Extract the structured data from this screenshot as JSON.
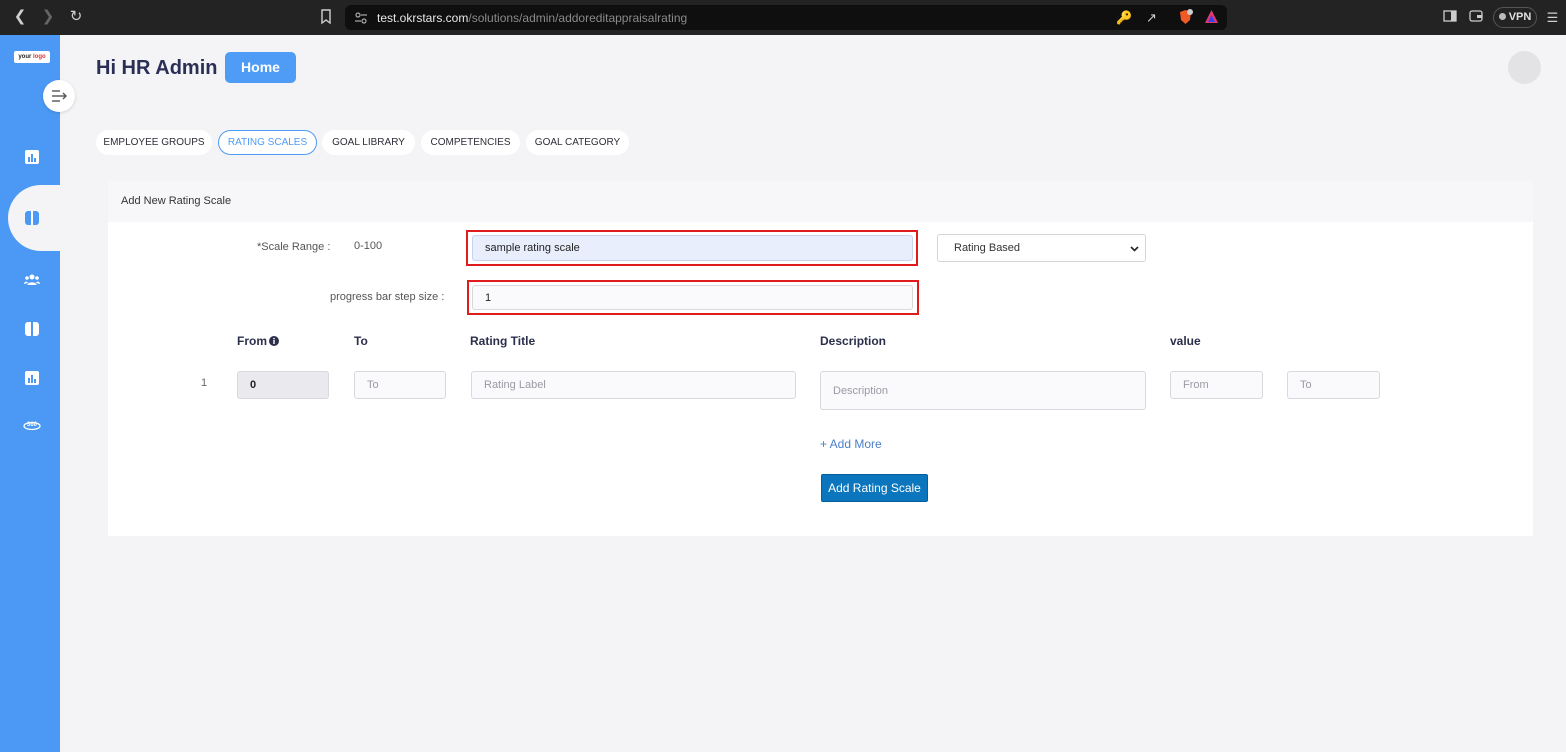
{
  "browser": {
    "url_host": "test.okrstars.com",
    "url_path": "/solutions/admin/addoreditappraisalrating",
    "vpn_label": "VPN"
  },
  "sidebar": {
    "logo_text_1": "your",
    "logo_text_2": "logo",
    "items": [
      {
        "icon": "bar-chart-icon"
      },
      {
        "icon": "panels-icon",
        "active": true
      },
      {
        "icon": "users-icon"
      },
      {
        "icon": "panels-icon"
      },
      {
        "icon": "bar-chart-icon"
      },
      {
        "icon": "360-icon"
      }
    ]
  },
  "header": {
    "greeting": "Hi HR Admin",
    "home_label": "Home"
  },
  "tabs": [
    {
      "label": "EMPLOYEE GROUPS",
      "active": false
    },
    {
      "label": "RATING SCALES",
      "active": true
    },
    {
      "label": "GOAL LIBRARY",
      "active": false
    },
    {
      "label": "COMPETENCIES",
      "active": false
    },
    {
      "label": "GOAL CATEGORY",
      "active": false
    }
  ],
  "form": {
    "title": "Add New Rating Scale",
    "scale_range_label": "*Scale Range :",
    "scale_range_value": "0-100",
    "scale_name_value": "sample rating scale",
    "rating_type_selected": "Rating Based",
    "step_size_label": "progress bar step size :",
    "step_size_value": "1",
    "columns": {
      "from": "From",
      "to": "To",
      "rating_title": "Rating Title",
      "description": "Description",
      "value": "value"
    },
    "rows": [
      {
        "index": "1",
        "from_value": "0",
        "to_placeholder": "To",
        "rating_label_placeholder": "Rating Label",
        "description_placeholder": "Description",
        "value_from_placeholder": "From",
        "value_to_placeholder": "To"
      }
    ],
    "add_more_label": "+ Add More",
    "submit_label": "Add Rating Scale"
  },
  "colors": {
    "sidebar": "#4b99f4",
    "accent": "#4e9cf5",
    "submit": "#0b76bd",
    "highlight": "#e01b1b"
  }
}
